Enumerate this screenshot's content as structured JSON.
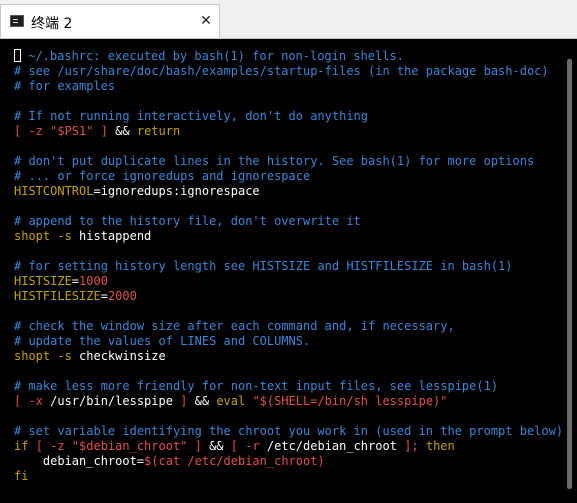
{
  "tab": {
    "title": "终端 2",
    "close_glyph": "✕",
    "icon": "terminal-icon"
  },
  "lines": [
    [
      {
        "t": "c",
        "v": " ~/.bashrc: executed by bash(1) for non-login shells."
      }
    ],
    [
      {
        "t": "c",
        "v": "# see /usr/share/doc/bash/examples/startup-files (in the package bash-doc)"
      }
    ],
    [
      {
        "t": "c",
        "v": "# for examples"
      }
    ],
    [],
    [
      {
        "t": "c",
        "v": "# If not running interactively, don't do anything"
      }
    ],
    [
      {
        "t": "r",
        "v": "[ -z \"$PS1\" ] "
      },
      {
        "t": "w",
        "v": "&& "
      },
      {
        "t": "s",
        "v": "return"
      }
    ],
    [],
    [
      {
        "t": "c",
        "v": "# don't put duplicate lines in the history. See bash(1) for more options"
      }
    ],
    [
      {
        "t": "c",
        "v": "# ... or force ignoredups and ignorespace"
      }
    ],
    [
      {
        "t": "s",
        "v": "HISTCONTROL"
      },
      {
        "t": "w",
        "v": "=ignoredups:ignorespace"
      }
    ],
    [],
    [
      {
        "t": "c",
        "v": "# append to the history file, don't overwrite it"
      }
    ],
    [
      {
        "t": "s",
        "v": "shopt -s "
      },
      {
        "t": "w",
        "v": "histappend"
      }
    ],
    [],
    [
      {
        "t": "c",
        "v": "# for setting history length see HISTSIZE and HISTFILESIZE in bash(1)"
      }
    ],
    [
      {
        "t": "s",
        "v": "HISTSIZE"
      },
      {
        "t": "w",
        "v": "="
      },
      {
        "t": "r",
        "v": "1000"
      }
    ],
    [
      {
        "t": "s",
        "v": "HISTFILESIZE"
      },
      {
        "t": "w",
        "v": "="
      },
      {
        "t": "r",
        "v": "2000"
      }
    ],
    [],
    [
      {
        "t": "c",
        "v": "# check the window size after each command and, if necessary,"
      }
    ],
    [
      {
        "t": "c",
        "v": "# update the values of LINES and COLUMNS."
      }
    ],
    [
      {
        "t": "s",
        "v": "shopt -s "
      },
      {
        "t": "w",
        "v": "checkwinsize"
      }
    ],
    [],
    [
      {
        "t": "c",
        "v": "# make less more friendly for non-text input files, see lesspipe(1)"
      }
    ],
    [
      {
        "t": "r",
        "v": "[ -x "
      },
      {
        "t": "w",
        "v": "/usr/bin/lesspipe "
      },
      {
        "t": "r",
        "v": "] "
      },
      {
        "t": "w",
        "v": "&& "
      },
      {
        "t": "s",
        "v": "eval "
      },
      {
        "t": "r",
        "v": "\"$(SHELL=/bin/sh lesspipe)\""
      }
    ],
    [],
    [
      {
        "t": "c",
        "v": "# set variable identifying the chroot you work in (used in the prompt below)"
      }
    ],
    [
      {
        "t": "s",
        "v": "if "
      },
      {
        "t": "r",
        "v": "[ -z \"$debian_chroot\" ] "
      },
      {
        "t": "w",
        "v": "&& "
      },
      {
        "t": "r",
        "v": "[ -r "
      },
      {
        "t": "w",
        "v": "/etc/debian_chroot "
      },
      {
        "t": "r",
        "v": "]; "
      },
      {
        "t": "s",
        "v": "then"
      }
    ],
    [
      {
        "t": "w",
        "v": "    debian_chroot="
      },
      {
        "t": "r",
        "v": "$(cat /etc/debian_chroot)"
      }
    ],
    [
      {
        "t": "s",
        "v": "fi"
      }
    ],
    []
  ]
}
